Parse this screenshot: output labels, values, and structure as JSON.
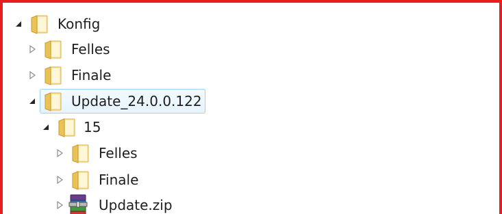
{
  "tree": {
    "nodes": [
      {
        "label": "Konfig",
        "icon": "folder-icon",
        "expander": "expanded"
      },
      {
        "label": "Felles",
        "icon": "folder-icon",
        "expander": "collapsed"
      },
      {
        "label": "Finale",
        "icon": "folder-icon",
        "expander": "collapsed"
      },
      {
        "label": "Update_24.0.0.122",
        "icon": "folder-icon",
        "expander": "expanded",
        "selected": true
      },
      {
        "label": "15",
        "icon": "folder-icon",
        "expander": "expanded"
      },
      {
        "label": "Felles",
        "icon": "folder-icon",
        "expander": "collapsed"
      },
      {
        "label": "Finale",
        "icon": "folder-icon",
        "expander": "collapsed"
      },
      {
        "label": "Update.zip",
        "icon": "archive-icon",
        "expander": "collapsed"
      }
    ]
  },
  "colors": {
    "frame_border": "#e81d1d",
    "selection_border": "#9ed1f3",
    "selection_fill": "#e6f4fe",
    "folder_light": "#fbe7a1",
    "folder_dark": "#e0b54a"
  }
}
